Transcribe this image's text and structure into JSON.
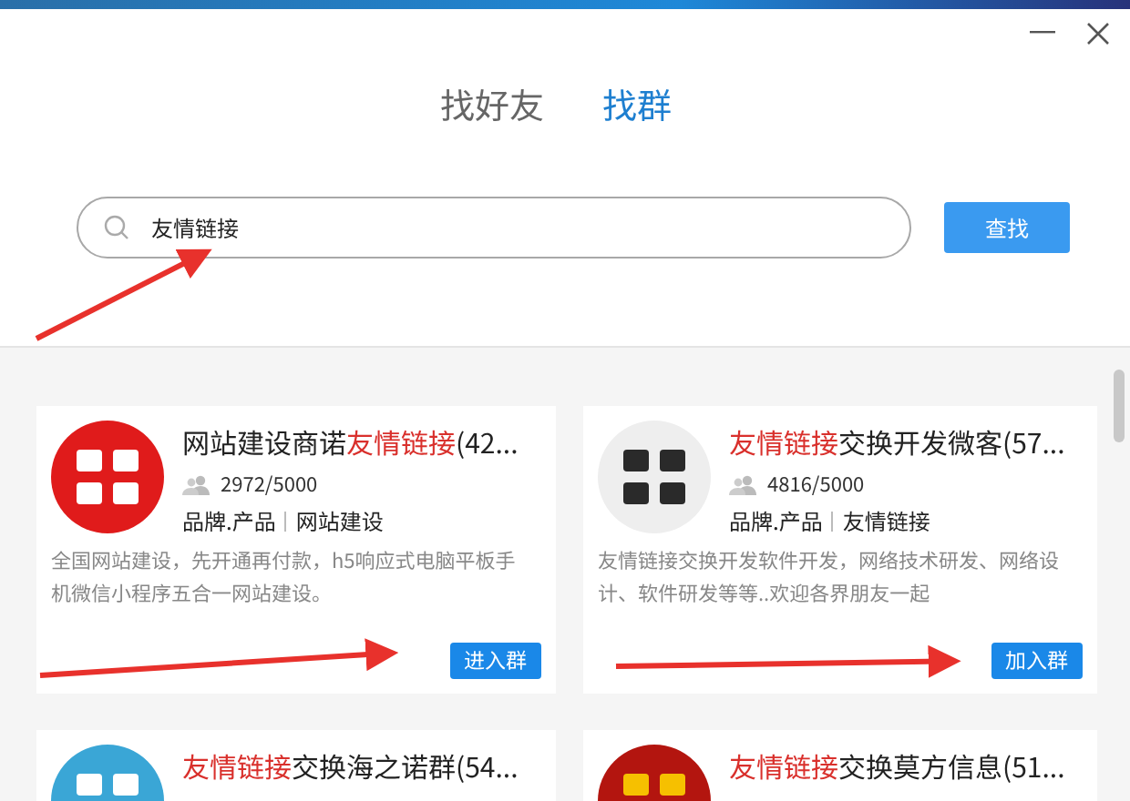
{
  "window": {
    "controls": [
      {
        "kind": "minimize"
      },
      {
        "kind": "close"
      }
    ]
  },
  "tabs": [
    {
      "label": "找好友",
      "selected": false
    },
    {
      "label": "找群",
      "selected": true
    }
  ],
  "search": {
    "value": "友情链接",
    "button": "查找"
  },
  "groups": [
    {
      "avatar": {
        "kind": "picture"
      },
      "title": [
        {
          "text": "网站建设商诺",
          "highlight": false
        },
        {
          "text": "友情链接",
          "highlight": true
        },
        {
          "text": "(42...",
          "highlight": false
        }
      ],
      "members": "2972/5000",
      "tags": [
        "品牌.产品",
        "网站建设"
      ],
      "description": "全国网站建设，先开通再付款，h5响应式电脑平板手机微信小程序五合一网站建设。",
      "button": "进入群"
    },
    {
      "avatar": {
        "kind": "picture"
      },
      "title": [
        {
          "text": "友情链接",
          "highlight": true
        },
        {
          "text": "交换开发微客(57...",
          "highlight": false
        }
      ],
      "members": "4816/5000",
      "tags": [
        "品牌.产品",
        "友情链接"
      ],
      "description": " 友情链接交换开发软件开发，网络技术研发、网络设计、软件研发等等..欢迎各界朋友一起",
      "button": "加入群"
    },
    {
      "avatar": {
        "kind": "picture"
      },
      "title": [
        {
          "text": "友情链接",
          "highlight": true
        },
        {
          "text": "交换海之诺群(54...",
          "highlight": false
        }
      ]
    },
    {
      "avatar": {
        "kind": "picture"
      },
      "title": [
        {
          "text": "友情链接",
          "highlight": true
        },
        {
          "text": "交换莫方信息(51...",
          "highlight": false
        }
      ]
    }
  ],
  "annotations": [
    {
      "kind": "arrow"
    },
    {
      "kind": "arrow"
    },
    {
      "kind": "arrow"
    }
  ]
}
